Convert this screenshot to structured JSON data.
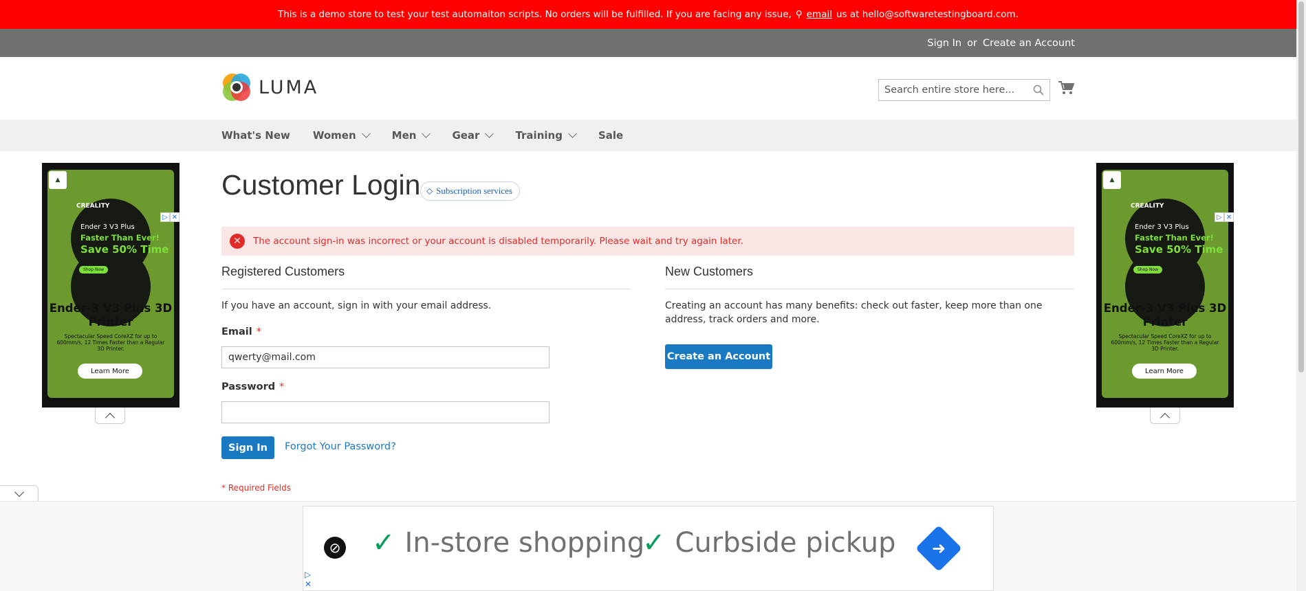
{
  "demo_notice": {
    "text": "This is a demo store to test your test automaiton scripts. No orders will be fulfilled. If you are facing any issue,",
    "link": "email",
    "suffix": "us at hello@softwaretestingboard.com."
  },
  "header_panel": {
    "sign_in": "Sign In",
    "or": "or",
    "create_account": "Create an Account"
  },
  "logo": {
    "text": "LUMA"
  },
  "search": {
    "placeholder": "Search entire store here..."
  },
  "nav": {
    "items": [
      "What's New",
      "Women",
      "Men",
      "Gear",
      "Training",
      "Sale"
    ]
  },
  "page": {
    "title": "Customer Login",
    "subscription_badge": "Subscription services"
  },
  "error_message": "The account sign-in was incorrect or your account is disabled temporarily. Please wait and try again later.",
  "registered": {
    "title": "Registered Customers",
    "intro": "If you have an account, sign in with your email address.",
    "email_label": "Email",
    "email_value": "qwerty@mail.com",
    "password_label": "Password",
    "password_value": "",
    "required_mark": "*",
    "sign_in_button": "Sign In",
    "forgot_link": "Forgot Your Password?",
    "required_note": "* Required Fields"
  },
  "new_customers": {
    "title": "New Customers",
    "text": "Creating an account has many benefits: check out faster, keep more than one address, track orders and more.",
    "button": "Create an Account"
  },
  "side_ad": {
    "brand": "CREALITY",
    "line1": "Ender 3 V3 Plus",
    "line2": "Faster Than Ever!",
    "line3": "Save 50% Time",
    "shop": "Shop Now",
    "title": "Ender-3 V3 Plus 3D Printer",
    "desc": "Spectacular Speed CoreXZ for up to 600mm/s, 12 Times Faster than a Regular 3D Printer.",
    "learn": "Learn More"
  },
  "bottom_ad": {
    "item1": "In-store shopping",
    "item2": "Curbside pickup"
  }
}
